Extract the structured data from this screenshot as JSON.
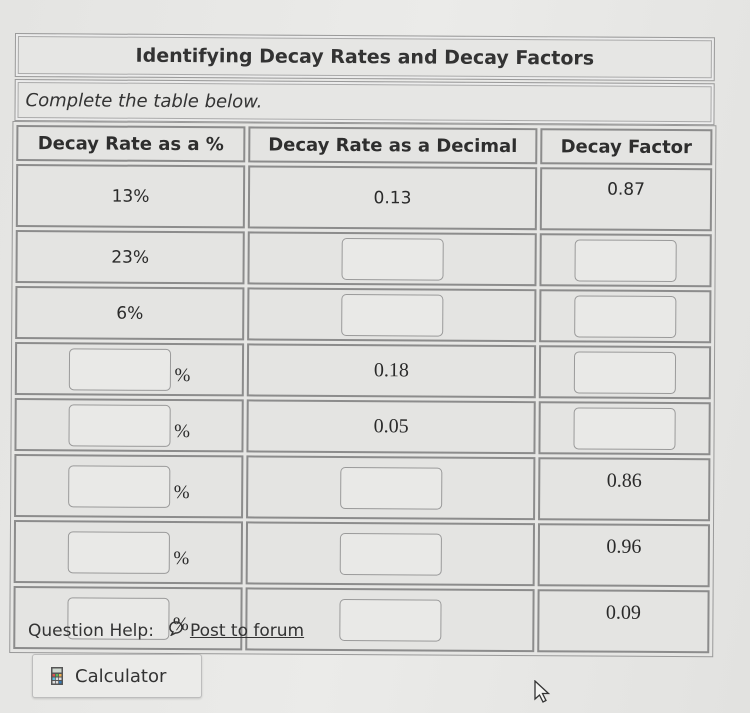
{
  "title": "Identifying Decay Rates and Decay Factors",
  "instruction": "Complete the table below.",
  "table": {
    "headers": [
      "Decay Rate as a %",
      "Decay Rate as a Decimal",
      "Decay Factor"
    ],
    "rows": [
      {
        "percent": "13%",
        "decimal": "0.13",
        "factor": "0.87"
      },
      {
        "percent": "23%",
        "decimal": "",
        "factor": ""
      },
      {
        "percent": "6%",
        "decimal": "",
        "factor": ""
      },
      {
        "percent": "",
        "decimal": "0.18",
        "factor": ""
      },
      {
        "percent": "",
        "decimal": "0.05",
        "factor": ""
      },
      {
        "percent": "",
        "decimal": "",
        "factor": "0.86"
      },
      {
        "percent": "",
        "decimal": "",
        "factor": "0.96"
      },
      {
        "percent": "",
        "decimal": "",
        "factor": "0.09"
      }
    ],
    "percent_suffix": "%"
  },
  "help": {
    "label": "Question Help:",
    "forum_icon": "speech-bubble-icon",
    "forum_link": "Post to forum"
  },
  "calculator": {
    "icon": "calculator-icon",
    "label": "Calculator"
  }
}
